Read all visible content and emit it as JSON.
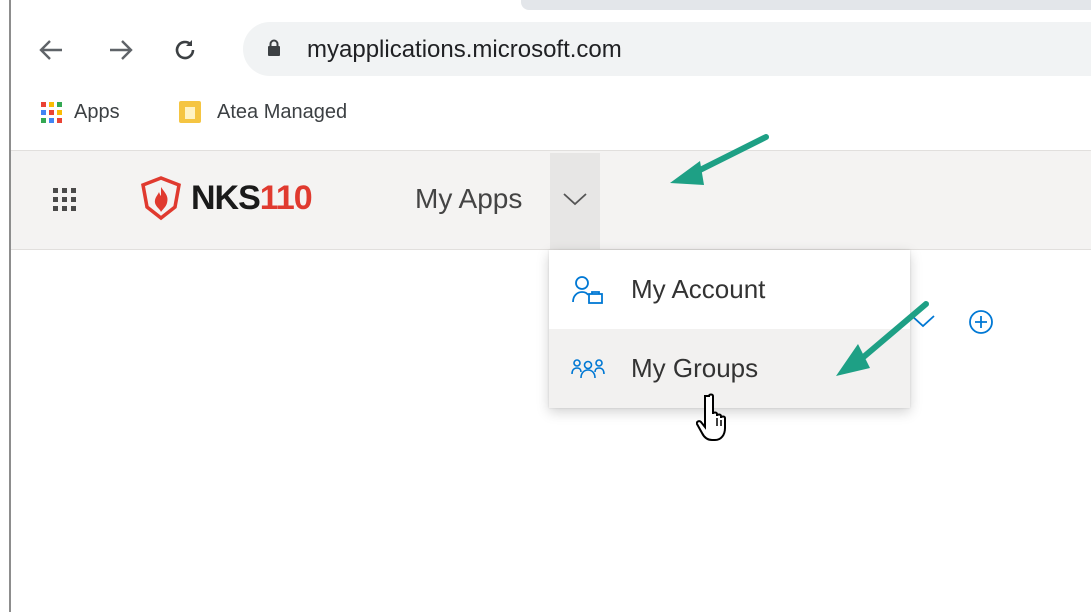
{
  "browser": {
    "url": "myapplications.microsoft.com",
    "bookmarks": [
      {
        "label": "Apps",
        "icon": "apps-grid-icon"
      },
      {
        "label": "Atea Managed",
        "icon": "folder-icon"
      }
    ]
  },
  "appbar": {
    "logo_text_dark": "NKS",
    "logo_text_red": "110",
    "menu_title": "My Apps"
  },
  "dropdown": {
    "items": [
      {
        "label": "My Account",
        "icon": "account-icon"
      },
      {
        "label": "My Groups",
        "icon": "groups-icon",
        "hovered": true
      }
    ]
  },
  "colors": {
    "accent_blue": "#0078d4",
    "annotation_arrow": "#1ea085",
    "logo_red": "#e03a2f"
  }
}
